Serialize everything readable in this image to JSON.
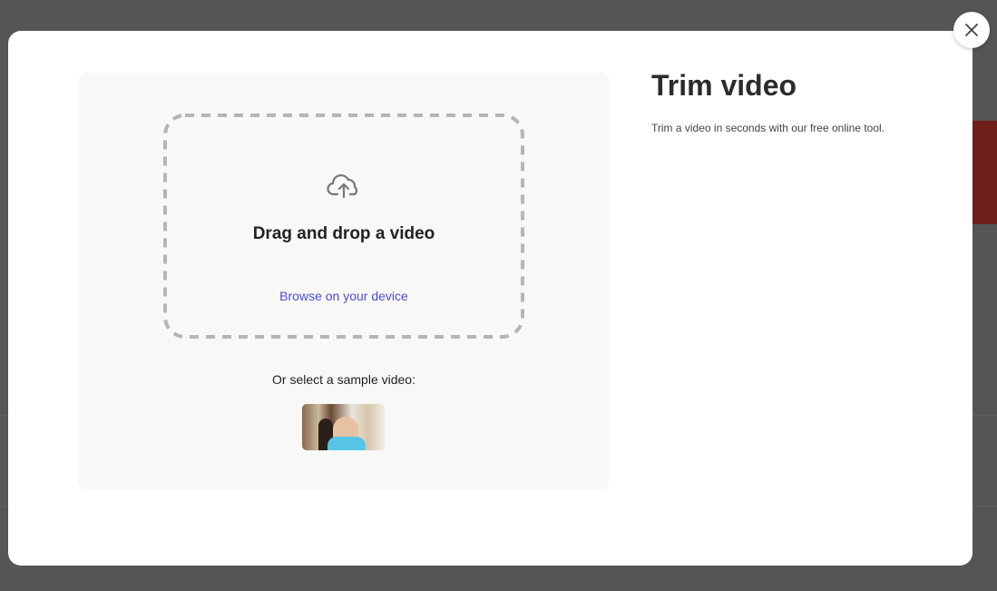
{
  "dialog": {
    "title": "Trim video",
    "description": "Trim a video in seconds with our free online tool.",
    "close_icon": "close-icon"
  },
  "upload": {
    "icon": "cloud-upload-icon",
    "heading": "Drag and drop a video",
    "browse_label": "Browse on your device",
    "sample_label": "Or select a sample video:"
  },
  "colors": {
    "link": "#4b4bdc",
    "overlay": "#555555",
    "panel": "#f8f8f6"
  }
}
